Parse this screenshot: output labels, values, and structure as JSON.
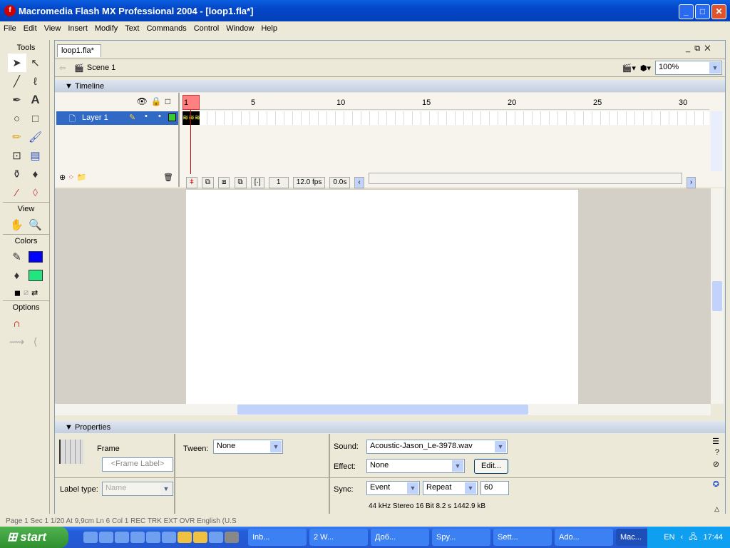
{
  "window": {
    "title": "Macromedia Flash MX Professional 2004 - [loop1.fla*]",
    "min": "_",
    "max": "□",
    "close": "✕"
  },
  "menu": [
    "File",
    "Edit",
    "View",
    "Insert",
    "Modify",
    "Text",
    "Commands",
    "Control",
    "Window",
    "Help"
  ],
  "toolbox": {
    "tools_label": "Tools",
    "view_label": "View",
    "colors_label": "Colors",
    "options_label": "Options",
    "tools": [
      "arrow-icon",
      "subselect-icon",
      "line-icon",
      "lasso-icon",
      "pen-icon",
      "text-icon",
      "oval-icon",
      "rectangle-icon",
      "pencil-icon",
      "brush-icon",
      "free-transform-icon",
      "fill-transform-icon",
      "ink-bottle-icon",
      "paint-bucket-icon",
      "eyedropper-icon",
      "eraser-icon"
    ],
    "stroke_color": "#0000ff",
    "fill_color": "#22e57f"
  },
  "document": {
    "tab": "loop1.fla*",
    "scene": "Scene 1",
    "zoom": "100%"
  },
  "timeline": {
    "title": "Timeline",
    "layer": "Layer 1",
    "ruler": [
      "1",
      "5",
      "10",
      "15",
      "20",
      "25",
      "30"
    ],
    "current_frame": "1",
    "fps": "12.0 fps",
    "time": "0.0s",
    "layer_color": "#33cc33",
    "playhead_color": "#ff8080"
  },
  "properties": {
    "title": "Properties",
    "frame_label": "Frame",
    "frame_label_placeholder": "<Frame Label>",
    "label_type_label": "Label type:",
    "label_type_value": "Name",
    "tween_label": "Tween:",
    "tween_value": "None",
    "sound_label": "Sound:",
    "sound_value": "Acoustic-Jason_Le-3978.wav",
    "effect_label": "Effect:",
    "effect_value": "None",
    "edit_button": "Edit...",
    "sync_label": "Sync:",
    "sync_value": "Event",
    "repeat_value": "Repeat",
    "repeat_count": "60",
    "sound_info": "44 kHz Stereo 16 Bit 8.2 s 1442.9 kB"
  },
  "statusbar_behind": "Page 1     Sec 1     1/20     At 9,9cm     Ln 6     Col 1     REC  TRK  EXT  OVR  English (U.S",
  "taskbar": {
    "start": "start",
    "tasks": [
      "Inb...",
      "2 W...",
      "Доб...",
      "Spy...",
      "Sett...",
      "Ado...",
      "Mac..."
    ],
    "lang": "EN",
    "clock": "17:44"
  }
}
